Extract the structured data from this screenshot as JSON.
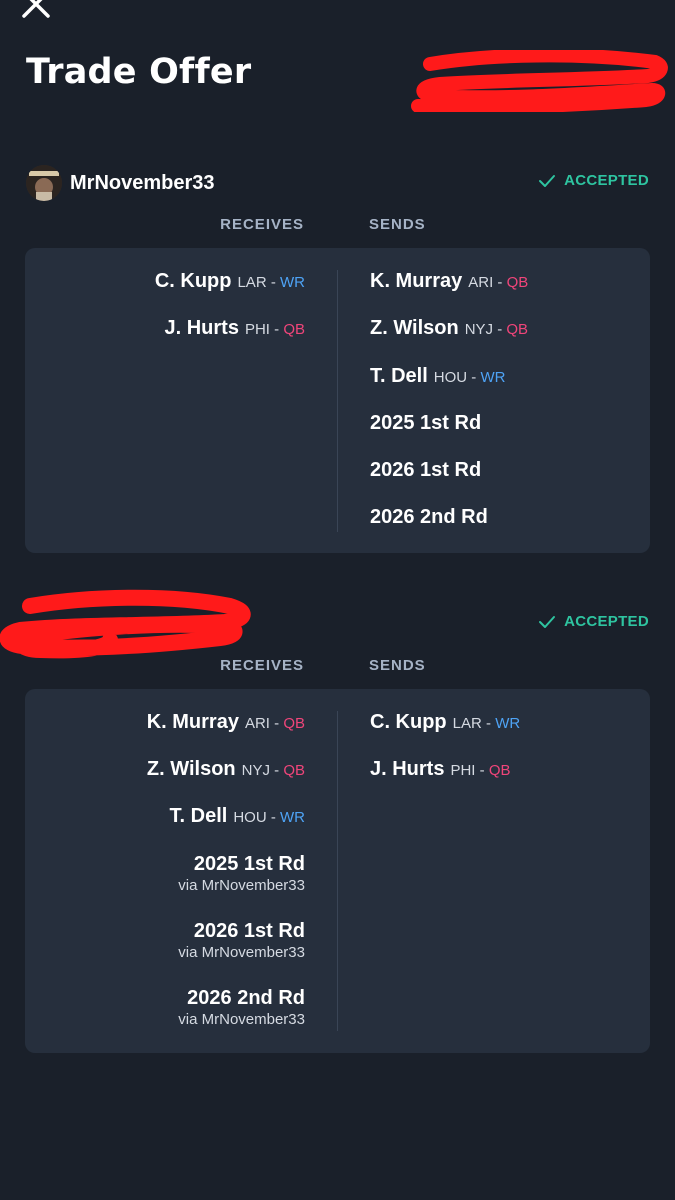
{
  "header": {
    "title": "Trade Offer"
  },
  "status_label": "ACCEPTED",
  "columns": {
    "receives": "RECEIVES",
    "sends": "SENDS"
  },
  "colors": {
    "qb": "#f0457a",
    "wr": "#4ea3f5",
    "accepted": "#2ec4a0",
    "background": "#1a202a",
    "card": "#262f3d"
  },
  "trades": [
    {
      "username": "MrNovember33",
      "receives": [
        {
          "name": "C. Kupp",
          "team": "LAR",
          "pos": "WR"
        },
        {
          "name": "J. Hurts",
          "team": "PHI",
          "pos": "QB"
        }
      ],
      "sends": [
        {
          "name": "K. Murray",
          "team": "ARI",
          "pos": "QB"
        },
        {
          "name": "Z. Wilson",
          "team": "NYJ",
          "pos": "QB"
        },
        {
          "name": "T. Dell",
          "team": "HOU",
          "pos": "WR"
        },
        {
          "name": "2025 1st Rd"
        },
        {
          "name": "2026 1st Rd"
        },
        {
          "name": "2026 2nd Rd"
        }
      ]
    },
    {
      "username": "",
      "receives": [
        {
          "name": "K. Murray",
          "team": "ARI",
          "pos": "QB"
        },
        {
          "name": "Z. Wilson",
          "team": "NYJ",
          "pos": "QB"
        },
        {
          "name": "T. Dell",
          "team": "HOU",
          "pos": "WR"
        },
        {
          "name": "2025 1st Rd",
          "via": "via MrNovember33"
        },
        {
          "name": "2026 1st Rd",
          "via": "via MrNovember33"
        },
        {
          "name": "2026 2nd Rd",
          "via": "via MrNovember33"
        }
      ],
      "sends": [
        {
          "name": "C. Kupp",
          "team": "LAR",
          "pos": "WR"
        },
        {
          "name": "J. Hurts",
          "team": "PHI",
          "pos": "QB"
        }
      ]
    }
  ]
}
